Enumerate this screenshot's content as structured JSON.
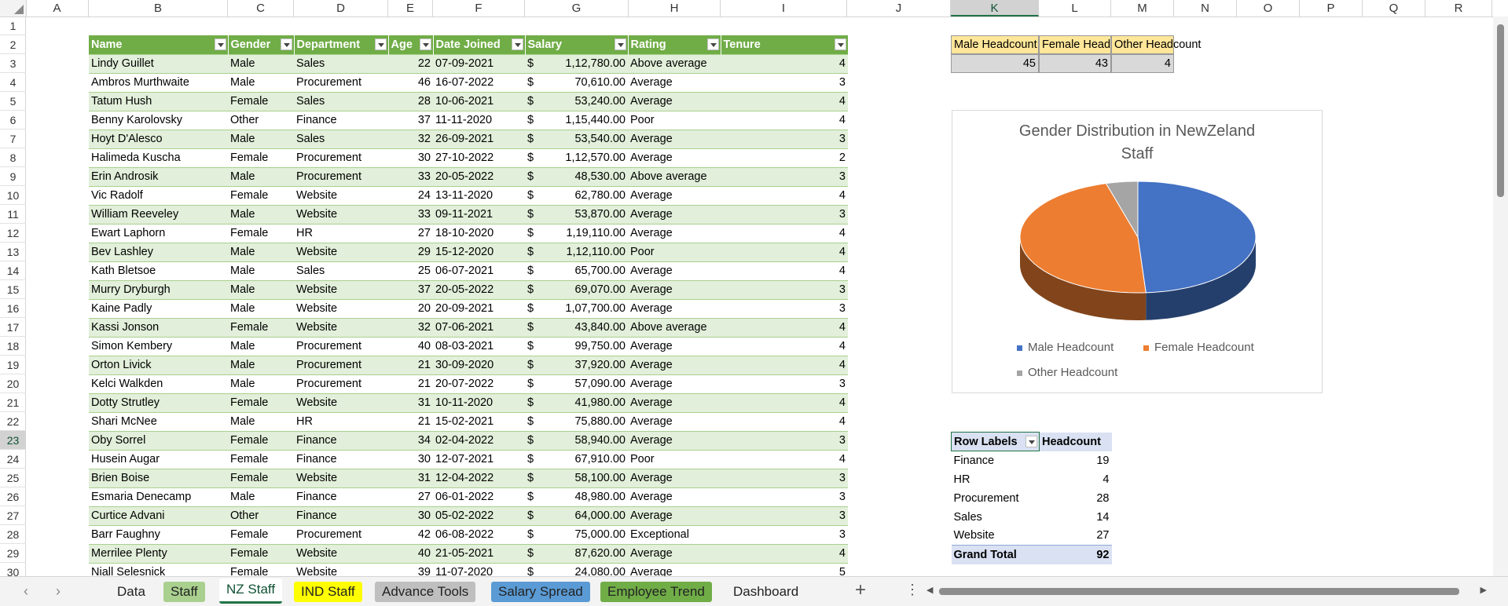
{
  "columns": [
    "A",
    "B",
    "C",
    "D",
    "E",
    "F",
    "G",
    "H",
    "I",
    "J",
    "K",
    "L",
    "M",
    "N",
    "O",
    "P",
    "Q",
    "R"
  ],
  "rows": [
    "1",
    "2",
    "3",
    "4",
    "5",
    "6",
    "7",
    "8",
    "9",
    "10",
    "11",
    "12",
    "13",
    "14",
    "15",
    "16",
    "17",
    "18",
    "19",
    "20",
    "21",
    "22",
    "23",
    "24",
    "25",
    "26",
    "27",
    "28",
    "29",
    "30"
  ],
  "table": {
    "headers": [
      "Name",
      "Gender",
      "Department",
      "Age",
      "Date Joined",
      "Salary",
      "Rating",
      "Tenure"
    ],
    "currency": "$",
    "rows": [
      [
        "Lindy Guillet",
        "Male",
        "Sales",
        "22",
        "07-09-2021",
        "1,12,780.00",
        "Above average",
        "4"
      ],
      [
        "Ambros Murthwaite",
        "Male",
        "Procurement",
        "46",
        "16-07-2022",
        "70,610.00",
        "Average",
        "3"
      ],
      [
        "Tatum Hush",
        "Female",
        "Sales",
        "28",
        "10-06-2021",
        "53,240.00",
        "Average",
        "4"
      ],
      [
        "Benny Karolovsky",
        "Other",
        "Finance",
        "37",
        "11-11-2020",
        "1,15,440.00",
        "Poor",
        "4"
      ],
      [
        "Hoyt D'Alesco",
        "Male",
        "Sales",
        "32",
        "26-09-2021",
        "53,540.00",
        "Average",
        "3"
      ],
      [
        "Halimeda Kuscha",
        "Female",
        "Procurement",
        "30",
        "27-10-2022",
        "1,12,570.00",
        "Average",
        "2"
      ],
      [
        "Erin Androsik",
        "Male",
        "Procurement",
        "33",
        "20-05-2022",
        "48,530.00",
        "Above average",
        "3"
      ],
      [
        "Vic Radolf",
        "Female",
        "Website",
        "24",
        "13-11-2020",
        "62,780.00",
        "Average",
        "4"
      ],
      [
        "William Reeveley",
        "Male",
        "Website",
        "33",
        "09-11-2021",
        "53,870.00",
        "Average",
        "3"
      ],
      [
        "Ewart Laphorn",
        "Female",
        "HR",
        "27",
        "18-10-2020",
        "1,19,110.00",
        "Average",
        "4"
      ],
      [
        "Bev Lashley",
        "Male",
        "Website",
        "29",
        "15-12-2020",
        "1,12,110.00",
        "Poor",
        "4"
      ],
      [
        "Kath Bletsoe",
        "Male",
        "Sales",
        "25",
        "06-07-2021",
        "65,700.00",
        "Average",
        "4"
      ],
      [
        "Murry Dryburgh",
        "Male",
        "Website",
        "37",
        "20-05-2022",
        "69,070.00",
        "Average",
        "3"
      ],
      [
        "Kaine Padly",
        "Male",
        "Website",
        "20",
        "20-09-2021",
        "1,07,700.00",
        "Average",
        "3"
      ],
      [
        "Kassi Jonson",
        "Female",
        "Website",
        "32",
        "07-06-2021",
        "43,840.00",
        "Above average",
        "4"
      ],
      [
        "Simon Kembery",
        "Male",
        "Procurement",
        "40",
        "08-03-2021",
        "99,750.00",
        "Average",
        "4"
      ],
      [
        "Orton Livick",
        "Male",
        "Procurement",
        "21",
        "30-09-2020",
        "37,920.00",
        "Average",
        "4"
      ],
      [
        "Kelci Walkden",
        "Male",
        "Procurement",
        "21",
        "20-07-2022",
        "57,090.00",
        "Average",
        "3"
      ],
      [
        "Dotty Strutley",
        "Female",
        "Website",
        "31",
        "10-11-2020",
        "41,980.00",
        "Average",
        "4"
      ],
      [
        "Shari McNee",
        "Male",
        "HR",
        "21",
        "15-02-2021",
        "75,880.00",
        "Average",
        "4"
      ],
      [
        "Oby Sorrel",
        "Female",
        "Finance",
        "34",
        "02-04-2022",
        "58,940.00",
        "Average",
        "3"
      ],
      [
        "Husein Augar",
        "Female",
        "Finance",
        "30",
        "12-07-2021",
        "67,910.00",
        "Poor",
        "4"
      ],
      [
        "Brien Boise",
        "Female",
        "Website",
        "31",
        "12-04-2022",
        "58,100.00",
        "Average",
        "3"
      ],
      [
        "Esmaria Denecamp",
        "Male",
        "Finance",
        "27",
        "06-01-2022",
        "48,980.00",
        "Average",
        "3"
      ],
      [
        "Curtice Advani",
        "Other",
        "Finance",
        "30",
        "05-02-2022",
        "64,000.00",
        "Average",
        "3"
      ],
      [
        "Barr Faughny",
        "Female",
        "Procurement",
        "42",
        "06-08-2022",
        "75,000.00",
        "Exceptional",
        "3"
      ],
      [
        "Merrilee Plenty",
        "Female",
        "Website",
        "40",
        "21-05-2021",
        "87,620.00",
        "Average",
        "4"
      ],
      [
        "Niall Selesnick",
        "Female",
        "Website",
        "39",
        "11-07-2020",
        "24,080.00",
        "Average",
        "5"
      ]
    ]
  },
  "headcount": {
    "headers": [
      "Male Headcount",
      "Female Headcount",
      "Other Headcount"
    ],
    "values": [
      "45",
      "43",
      "4"
    ]
  },
  "chart_data": {
    "type": "pie",
    "title": "Gender Distribution in NewZeland Staff",
    "categories": [
      "Male Headcount",
      "Female Headcount",
      "Other Headcount"
    ],
    "values": [
      45,
      43,
      4
    ],
    "colors": [
      "#4472c4",
      "#ed7d31",
      "#a5a5a5"
    ],
    "legend": "bottom",
    "style": "3d"
  },
  "pivot": {
    "headers": [
      "Row Labels",
      "Headcount"
    ],
    "rows": [
      [
        "Finance",
        "19"
      ],
      [
        "HR",
        "4"
      ],
      [
        "Procurement",
        "28"
      ],
      [
        "Sales",
        "14"
      ],
      [
        "Website",
        "27"
      ]
    ],
    "total": [
      "Grand Total",
      "92"
    ]
  },
  "tabs": [
    {
      "label": "Data",
      "color": "none"
    },
    {
      "label": "Staff",
      "color": "#a9d08e"
    },
    {
      "label": "NZ Staff",
      "color": "active"
    },
    {
      "label": "IND Staff",
      "color": "#ffff00"
    },
    {
      "label": "Advance Tools",
      "color": "#bfbfbf"
    },
    {
      "label": "Salary Spread",
      "color": "#5b9bd5"
    },
    {
      "label": "Employee Trend",
      "color": "#70ad47"
    },
    {
      "label": "Dashboard",
      "color": "none"
    }
  ],
  "icons": {
    "prev": "chevron-left-icon",
    "next": "chevron-right-icon",
    "add": "plus-icon",
    "more": "more-vertical-icon"
  }
}
